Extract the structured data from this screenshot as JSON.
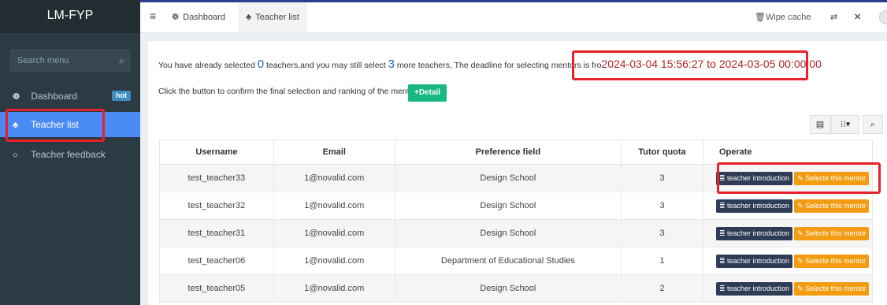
{
  "app": {
    "title": "LM-FYP"
  },
  "sidebar": {
    "search_placeholder": "Search menu",
    "search_icon": "🔍",
    "items": [
      {
        "label": "Dashboard",
        "icon": "dashboard-icon",
        "glyph": "❁",
        "badge": "hot"
      },
      {
        "label": "Teacher list",
        "icon": "user-icon",
        "glyph": "♣",
        "active": true
      },
      {
        "label": "Teacher feedback",
        "icon": "circle-icon",
        "glyph": "○"
      }
    ]
  },
  "topbar": {
    "menu_glyph": "≡",
    "tabs": [
      {
        "label": "Dashboard",
        "glyph": "❁"
      },
      {
        "label": "Teacher list",
        "glyph": "♣",
        "active": true
      }
    ],
    "wipe_cache": "Wipe cache",
    "wipe_glyph": "🗑",
    "lang_glyph": "⇄",
    "fullscreen_glyph": "✕"
  },
  "main": {
    "info": {
      "prefix": "You have already selected ",
      "selected_count": "0",
      "middle": " teachers,and you may still select ",
      "remaining_count": "3",
      "suffix": " more teachers, The deadline for selecting mentors is fro",
      "deadline": "2024-03-04 15:56:27 to 2024-03-05 00:00:00"
    },
    "confirm_text": "Click the button to confirm the final selection and ranking of the mentor",
    "detail_label": "+Detail",
    "toolbar": {
      "columns_glyph": "▤",
      "grid_glyph": "⁝⁝▾",
      "search_glyph": "⌕"
    },
    "table": {
      "headers": [
        "Username",
        "Email",
        "Preference field",
        "Tutor quota",
        "Operate"
      ],
      "intro_label": "≣ teacher introduction",
      "select_label": "✎ Selecte this mentor",
      "rows": [
        {
          "username": "test_teacher33",
          "email": "1@novalid.com",
          "field": "Design School",
          "quota": "3"
        },
        {
          "username": "test_teacher32",
          "email": "1@novalid.com",
          "field": "Design School",
          "quota": "3"
        },
        {
          "username": "test_teacher31",
          "email": "1@novalid.com",
          "field": "Design School",
          "quota": "3"
        },
        {
          "username": "test_teacher06",
          "email": "1@novalid.com",
          "field": "Department of Educational Studies",
          "quota": "1"
        },
        {
          "username": "test_teacher05",
          "email": "1@novalid.com",
          "field": "Design School",
          "quota": "2"
        }
      ]
    }
  },
  "colors": {
    "sidebar_bg": "#2b3a43",
    "active_item": "#4a8af4",
    "highlight_box": "#e8202a",
    "detail_button": "#18b87e",
    "select_button": "#f39c12",
    "intro_button": "#2f3c56"
  }
}
